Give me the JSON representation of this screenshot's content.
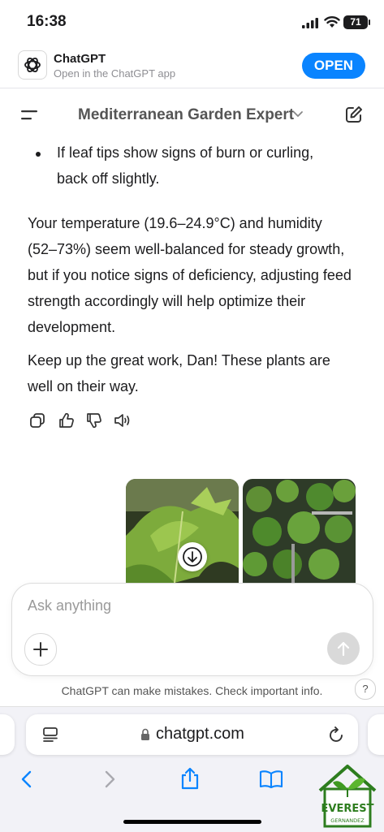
{
  "status_bar": {
    "time": "16:38",
    "battery": "71"
  },
  "app_banner": {
    "name": "ChatGPT",
    "subtitle": "Open in the ChatGPT app",
    "open_label": "OPEN"
  },
  "chat": {
    "title": "Mediterranean Garden Expert",
    "bullet": "If leaf tips show signs of burn or curling, back off slightly.",
    "paragraphs": [
      "Your temperature (19.6–24.9°C) and humidity (52–73%) seem well-balanced for steady growth, but if you notice signs of deficiency, adjusting feed strength accordingly will help optimize their development.",
      "Keep up the great work, Dan! These plants are well on their way."
    ],
    "actions": [
      "copy-icon",
      "thumbs-up-icon",
      "thumbs-down-icon",
      "speaker-icon"
    ]
  },
  "composer": {
    "placeholder": "Ask anything"
  },
  "disclaimer": "ChatGPT can make mistakes. Check important info.",
  "help_label": "?",
  "browser": {
    "url": "chatgpt.com"
  },
  "watermark": {
    "text": "EVEREST",
    "subtext": "GERNANDEZ"
  },
  "colors": {
    "accent": "#0a84ff",
    "leaf_green": "#4c8f2a",
    "send_disabled": "#d9d9d9"
  }
}
